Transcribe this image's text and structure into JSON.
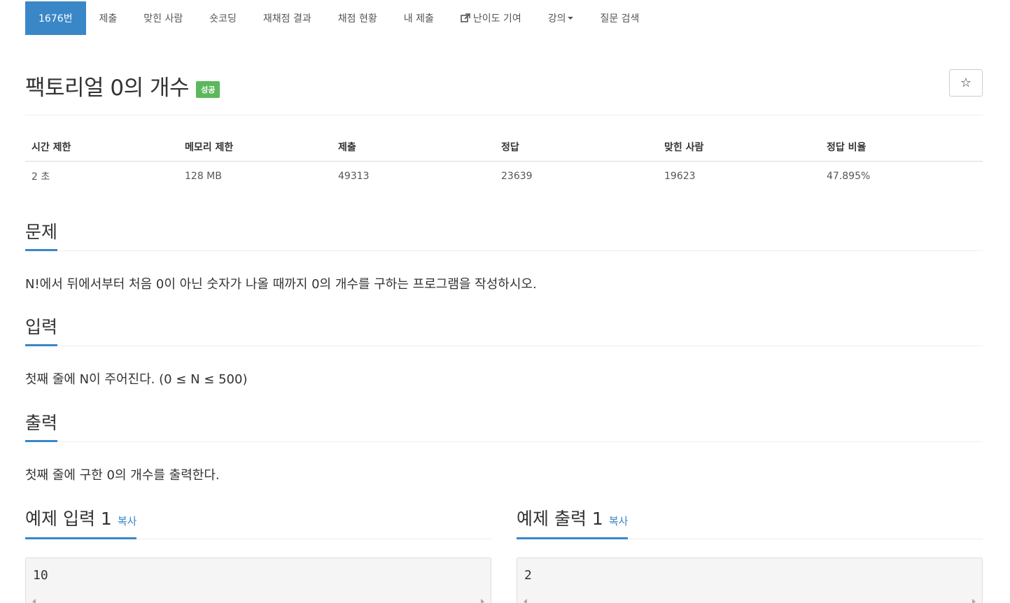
{
  "nav": {
    "items": [
      {
        "label": "1676번",
        "active": true
      },
      {
        "label": "제출"
      },
      {
        "label": "맞힌 사람"
      },
      {
        "label": "숏코딩"
      },
      {
        "label": "재채점 결과"
      },
      {
        "label": "채점 현황"
      },
      {
        "label": "내 제출"
      },
      {
        "label": "난이도 기여",
        "icon": "external-link-icon"
      },
      {
        "label": "강의",
        "icon": "caret-down-icon"
      },
      {
        "label": "질문 검색"
      }
    ]
  },
  "problem": {
    "title": "팩토리얼 0의 개수",
    "badge": "성공",
    "star": "☆"
  },
  "stats": {
    "headers": [
      "시간 제한",
      "메모리 제한",
      "제출",
      "정답",
      "맞힌 사람",
      "정답 비율"
    ],
    "values": [
      "2 초",
      "128 MB",
      "49313",
      "23639",
      "19623",
      "47.895%"
    ]
  },
  "sections": {
    "problem_head": "문제",
    "problem_text": "N!에서 뒤에서부터 처음 0이 아닌 숫자가 나올 때까지 0의 개수를 구하는 프로그램을 작성하시오.",
    "input_head": "입력",
    "input_text": "첫째 줄에 N이 주어진다. (0 ≤ N ≤ 500)",
    "output_head": "출력",
    "output_text": "첫째 줄에 구한 0의 개수를 출력한다."
  },
  "samples": {
    "input_title": "예제 입력 1",
    "output_title": "예제 출력 1",
    "copy_label": "복사",
    "input_value": "10",
    "output_value": "2"
  },
  "colors": {
    "accent": "#3a87c8",
    "success": "#5cb85c"
  }
}
